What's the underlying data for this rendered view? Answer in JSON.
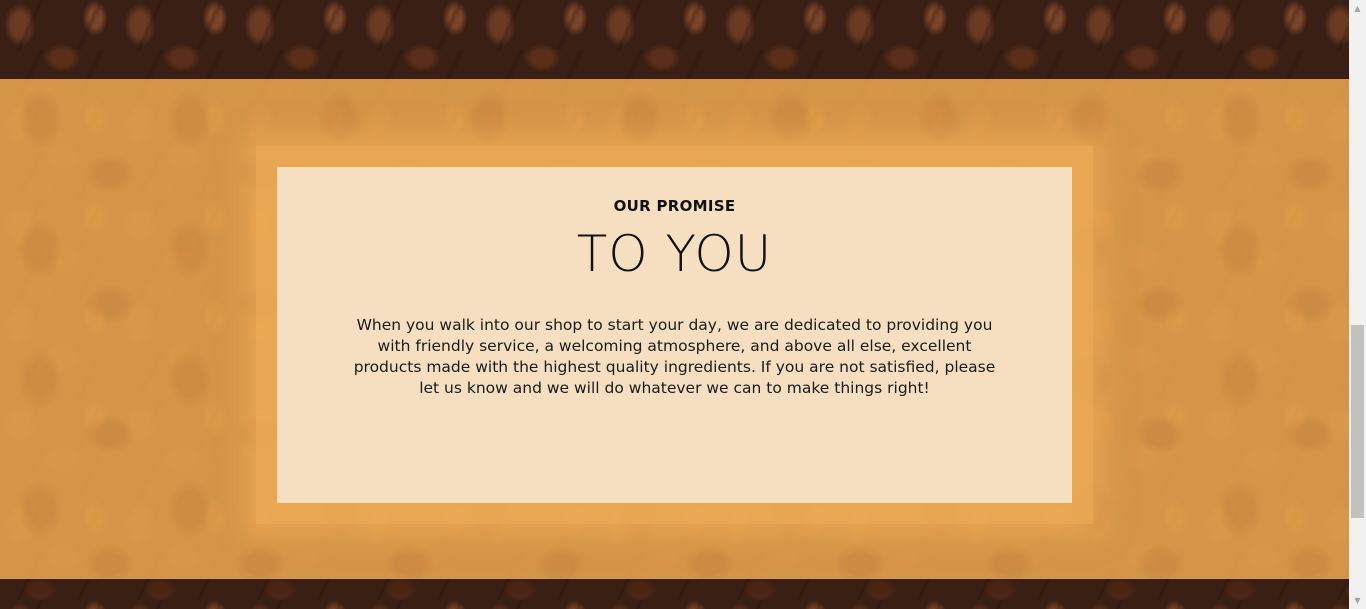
{
  "promise": {
    "eyebrow": "OUR PROMISE",
    "headline": "TO YOU",
    "body": "When you walk into our shop to start your day, we are dedicated to providing you with friendly service, a welcoming atmosphere, and above all else, excellent products made with the highest quality ingredients. If you are not satisfied, please let us know and we will do whatever we can to make things right!"
  },
  "colors": {
    "band": "#e6a24e",
    "card": "#f6dfc1",
    "bean_dark": "#3a1f14"
  },
  "icons": {
    "scroll_up": "scroll-up-arrow-icon",
    "scroll_down": "scroll-down-arrow-icon"
  }
}
